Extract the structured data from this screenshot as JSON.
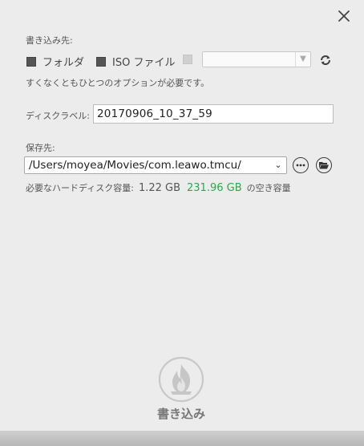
{
  "dest_label": "書き込み先:",
  "options": [
    {
      "label": "フォルダ",
      "checked": false
    },
    {
      "label": "ISO ファイル",
      "checked": false
    }
  ],
  "drive_select_value": "",
  "warning": "すくなくともひとつのオプションが必要です。",
  "disc_label": {
    "label": "ディスクラベル:",
    "value": "20170906_10_37_59"
  },
  "save_to": {
    "label": "保存先:",
    "path": "/Users/moyea/Movies/com.leawo.tmcu/"
  },
  "disk_space": {
    "required_label": "必要なハードディスク容量:",
    "required_value": "1.22 GB",
    "free_value": "231.96 GB",
    "free_suffix": "の空き容量",
    "free_color": "#2aa84a"
  },
  "burn_label": "書き込み"
}
